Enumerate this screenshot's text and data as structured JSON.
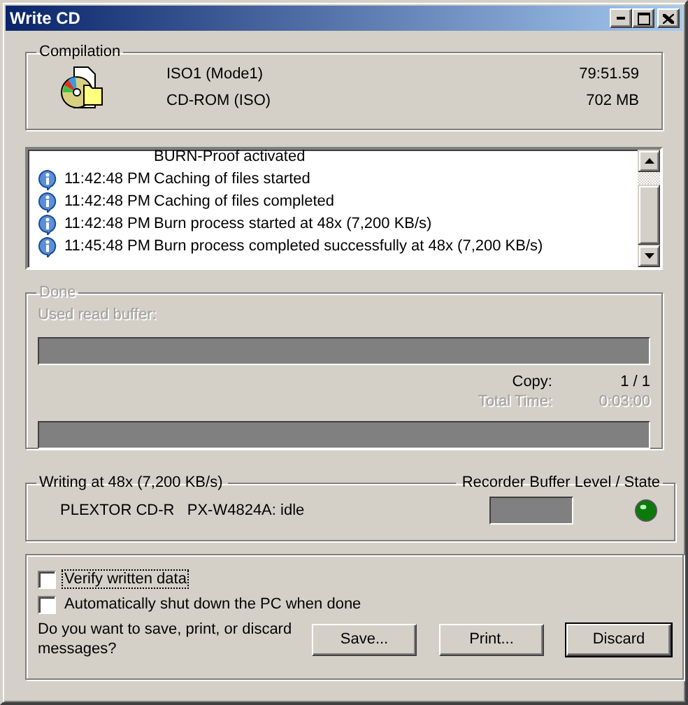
{
  "window": {
    "title": "Write CD"
  },
  "compilation": {
    "title": "Compilation",
    "name": "ISO1 (Mode1)",
    "type": "CD-ROM (ISO)",
    "length": "79:51.59",
    "size": "702 MB"
  },
  "log": [
    {
      "kind": "continuation",
      "message": "BURN-Proof activated"
    },
    {
      "kind": "info",
      "time": "11:42:48 PM",
      "message": "Caching of files started"
    },
    {
      "kind": "info",
      "time": "11:42:48 PM",
      "message": "Caching of files completed"
    },
    {
      "kind": "info",
      "time": "11:42:48 PM",
      "message": "Burn process started at 48x (7,200 KB/s)"
    },
    {
      "kind": "info",
      "time": "11:45:48 PM",
      "message": "Burn process completed successfully at 48x (7,200 KB/s)"
    }
  ],
  "progress": {
    "title": "Done",
    "disabled": true,
    "buffer": {
      "label": "Used read buffer:",
      "level": 0
    },
    "copy_label": "Copy:",
    "copy_value": "1 / 1",
    "time_label": "Total Time:",
    "time_value": "0:03:00",
    "total": {
      "level": 0
    }
  },
  "recorder": {
    "title": "Writing at 48x (7,200 KB/s)",
    "buffer_title": "Recorder Buffer Level / State",
    "drive": "PLEXTOR CD-R   PX-W4824A: idle",
    "buffer": {
      "level": 0
    }
  },
  "options": [
    {
      "label": "Verify written data",
      "checked": false,
      "focused": true
    },
    {
      "label": "Automatically shut down the PC when done",
      "checked": false,
      "focused": false
    }
  ],
  "question": "Do you want to save, print, or discard messages?",
  "buttons": [
    {
      "label": "Save...",
      "default": false
    },
    {
      "label": "Print...",
      "default": false
    },
    {
      "label": "Discard",
      "default": true
    }
  ]
}
